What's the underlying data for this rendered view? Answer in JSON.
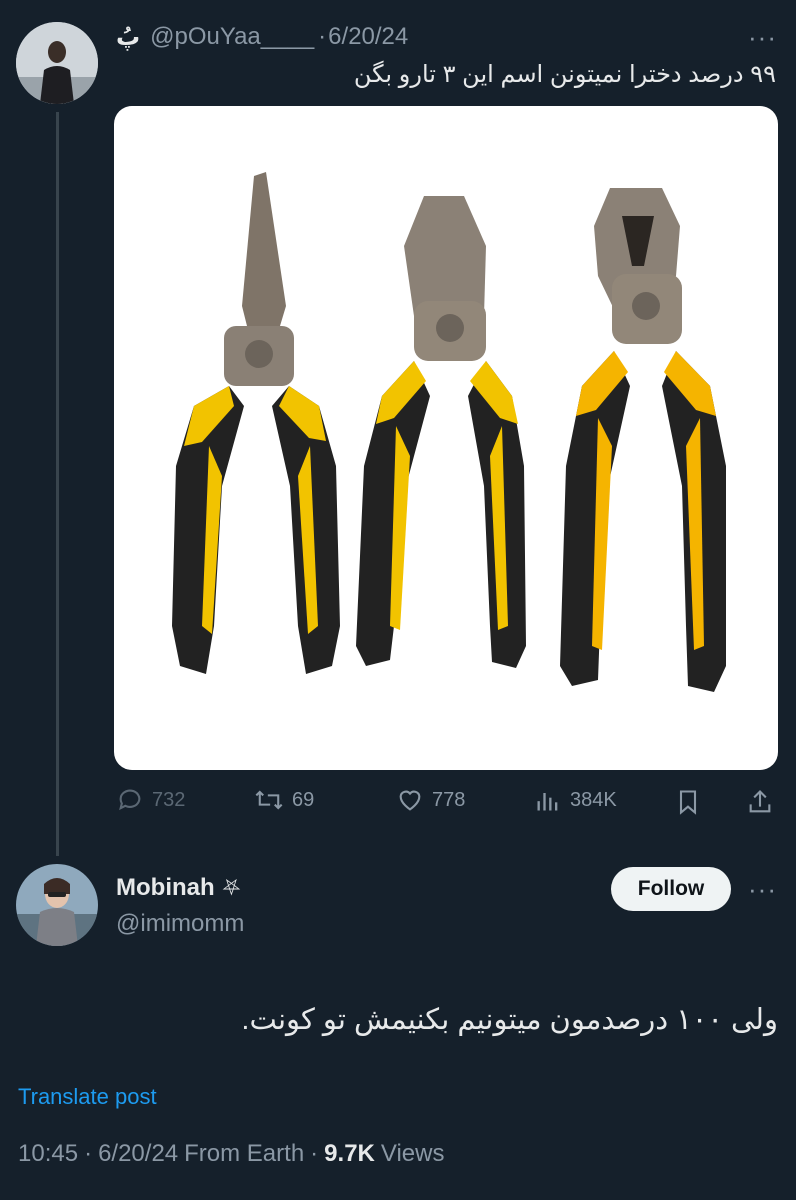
{
  "quoted_tweet": {
    "display_name": "پُ",
    "handle": "@pOuYaa____",
    "separator": "·",
    "date": "6/20/24",
    "text": "۹۹ درصد دخترا نمیتونن اسم این ۳ تارو بگن",
    "image_icon": "pliers-photo",
    "actions": {
      "replies": "732",
      "retweets": "69",
      "likes": "778",
      "views": "384K"
    }
  },
  "main_tweet": {
    "display_name": "Mobinah",
    "badge": "⛧",
    "handle": "@imimomm",
    "follow_label": "Follow",
    "text": "ولی ۱۰۰ درصدمون میتونیم بکنیمش تو کونت.",
    "translate_label": "Translate post",
    "meta": {
      "time": "10:45",
      "sep1": "·",
      "date": "6/20/24",
      "source": "From Earth",
      "sep2": "·",
      "views_count": "9.7K",
      "views_label": "Views"
    }
  },
  "colors": {
    "background": "#15202b",
    "text": "#e7e9ea",
    "muted": "#8b98a5",
    "link": "#1d9bf0",
    "follow_bg": "#eff3f4"
  }
}
